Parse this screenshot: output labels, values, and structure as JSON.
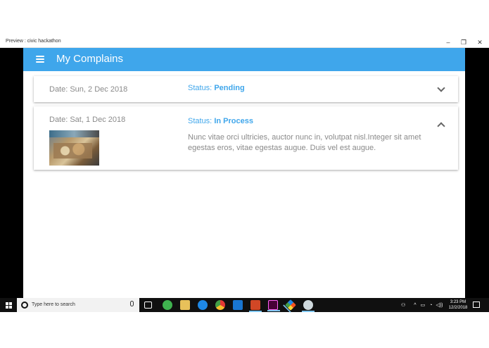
{
  "window": {
    "title": "Preview : civic hackathon",
    "minimize_glyph": "–",
    "restore_glyph": "❐",
    "close_glyph": "✕"
  },
  "app": {
    "title": "My Complains",
    "menu_icon": "hamburger-icon",
    "accent_color": "#3fa6eb"
  },
  "complaints": [
    {
      "date": "Date: Sun, 2 Dec 2018",
      "status_label": "Status:",
      "status_value": "Pending",
      "expanded": false
    },
    {
      "date": "Date: Sat, 1 Dec 2018",
      "status_label": "Status:",
      "status_value": "In Process",
      "expanded": true,
      "description": "Nunc vitae orci ultricies, auctor nunc in, volutpat nisl.Integer sit amet egestas eros, vitae egestas augue. Duis vel est augue."
    }
  ],
  "taskbar": {
    "search_placeholder": "Type here to search",
    "time": "3:23 PM",
    "date": "12/2/2018",
    "pinned_icons": [
      "task-view-icon",
      "app-green-icon",
      "file-explorer-icon",
      "edge-icon",
      "chrome-icon",
      "vscode-icon",
      "powerpoint-icon",
      "adobe-xd-icon",
      "git-icon",
      "app-misc-icon"
    ]
  }
}
